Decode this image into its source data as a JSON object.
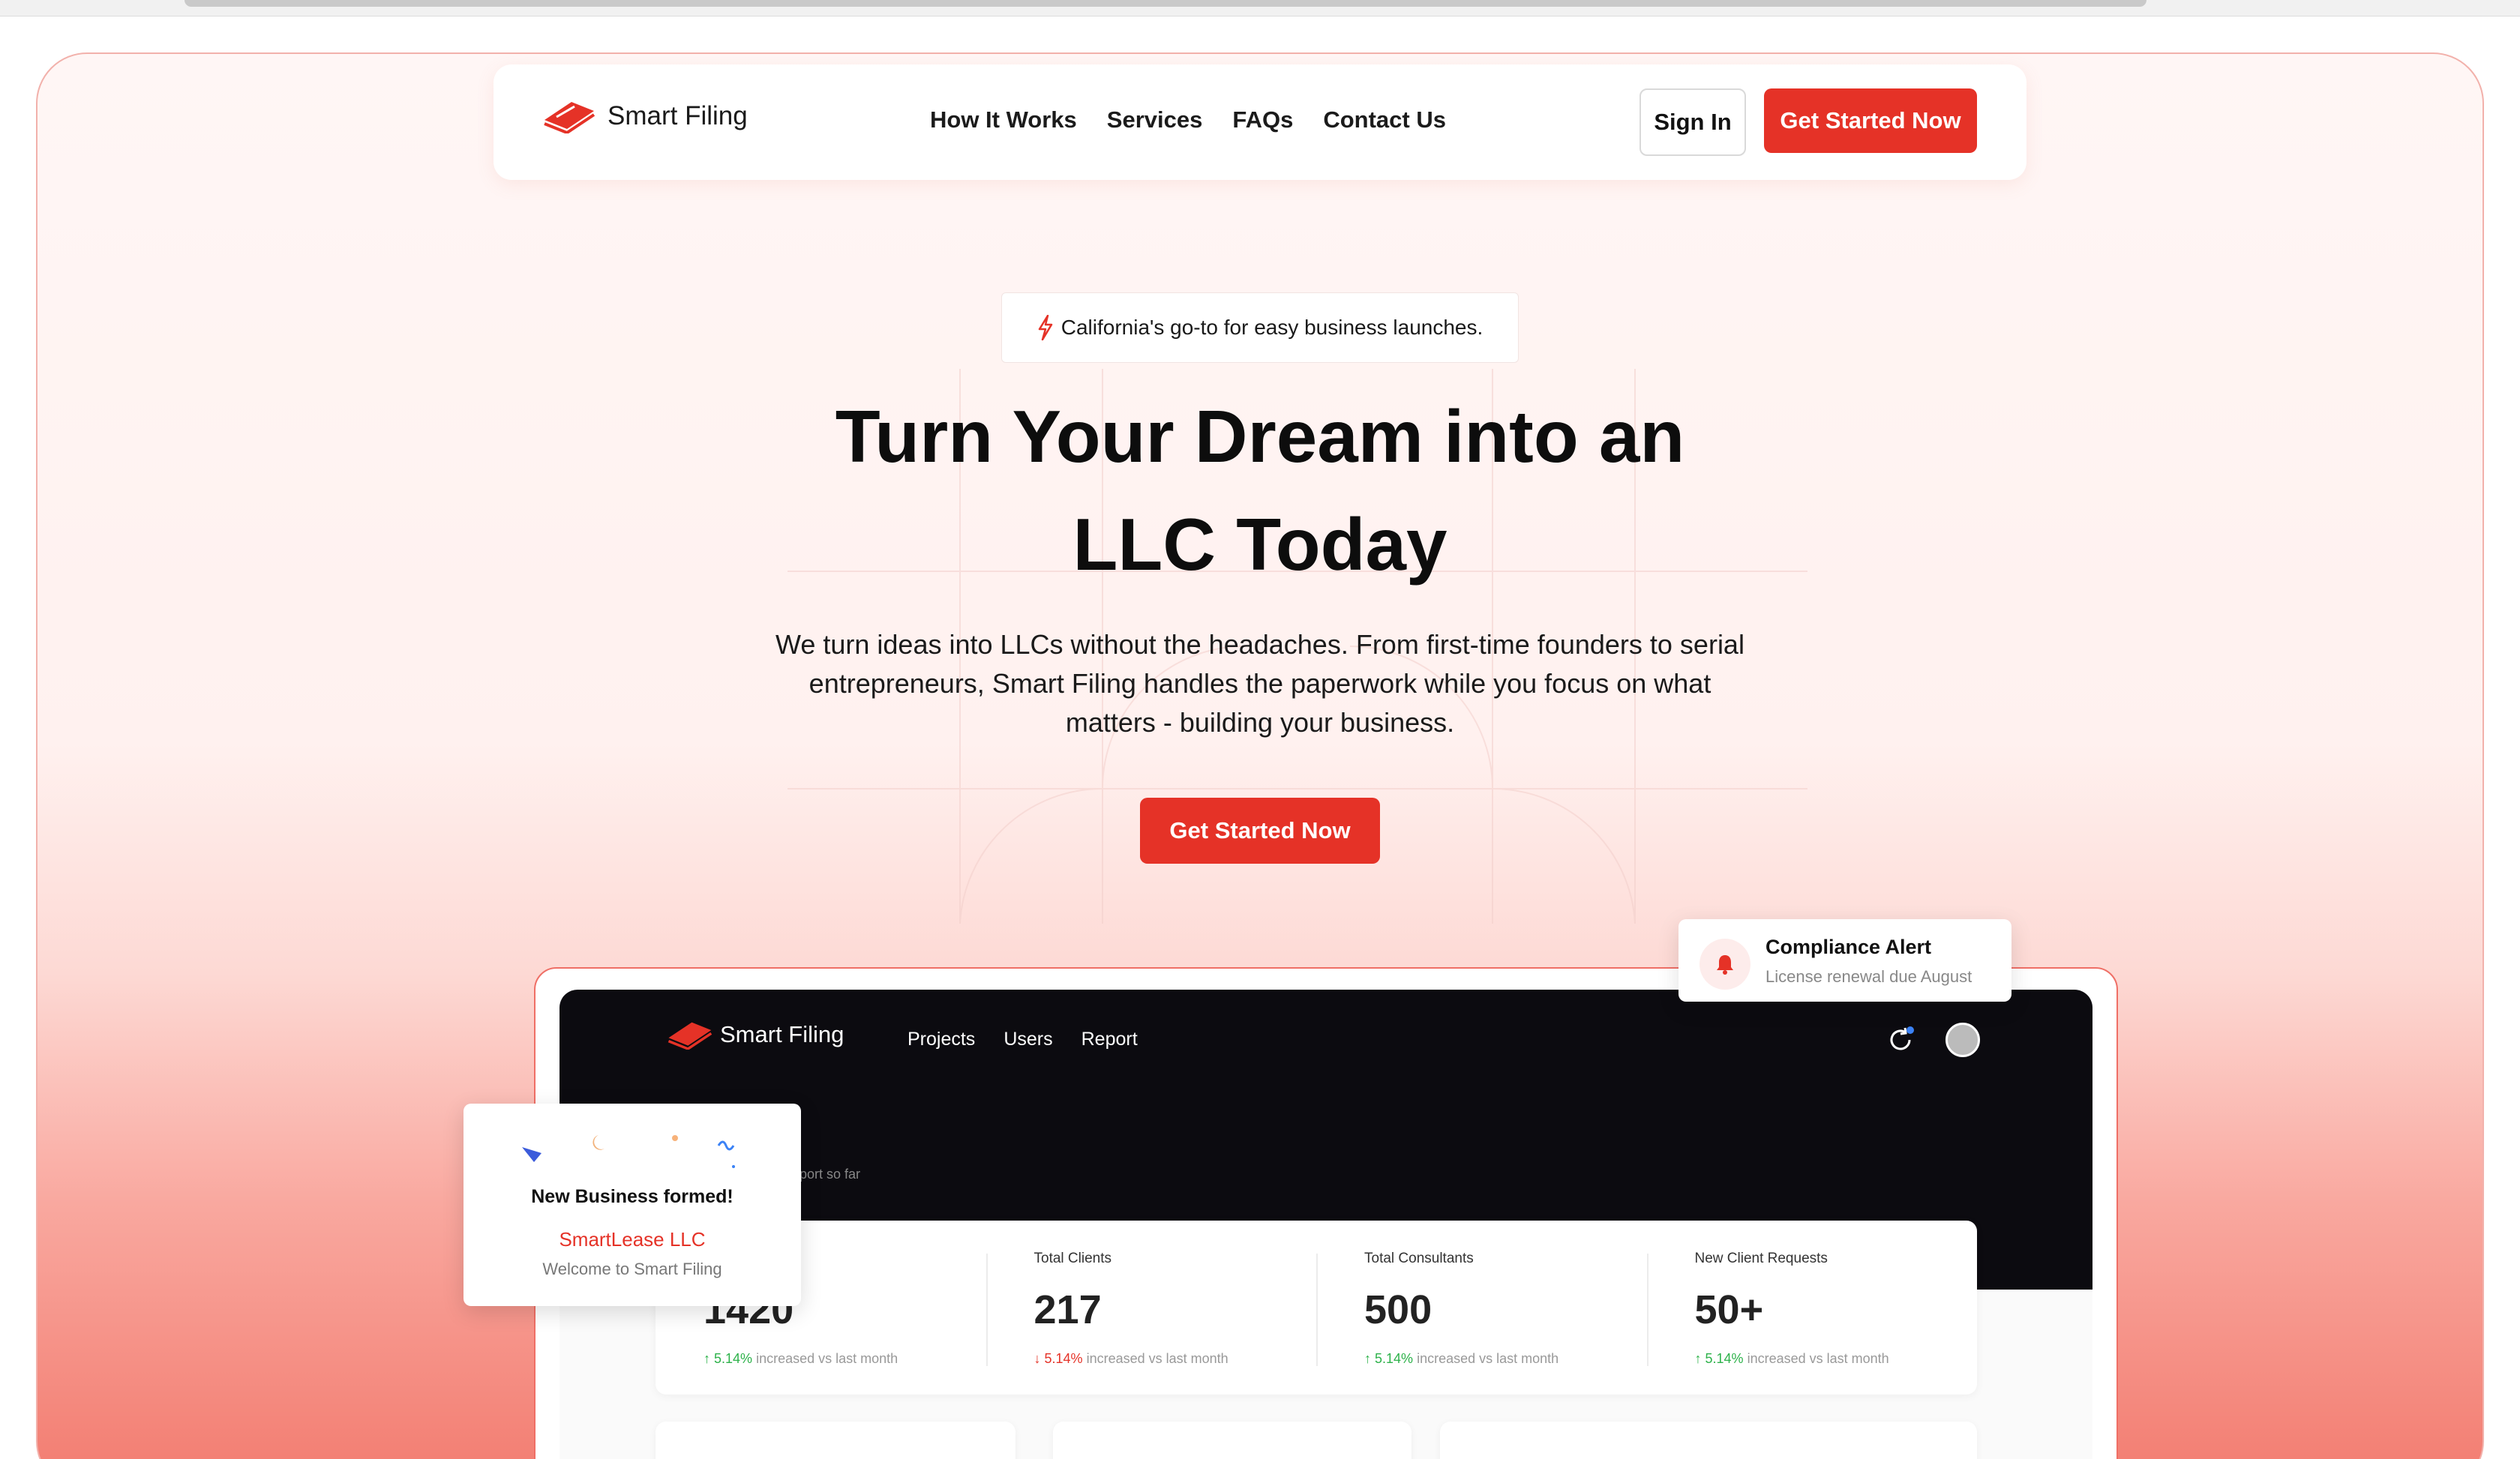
{
  "colors": {
    "accent": "#e53227",
    "dark": "#0c0b10",
    "trend_up": "#2db24a",
    "trend_down": "#e53227"
  },
  "nav": {
    "brand": "Smart Filing",
    "links": [
      "How It Works",
      "Services",
      "FAQs",
      "Contact Us"
    ],
    "sign_in": "Sign In",
    "cta": "Get Started Now"
  },
  "hero": {
    "tag_icon": "bolt-icon",
    "tag": "California's go-to for easy business launches.",
    "title_line1": "Turn Your Dream into an",
    "title_line2": "LLC Today",
    "subtitle": "We turn ideas into LLCs without the headaches. From first-time founders to serial entrepreneurs, Smart Filing handles the paperwork while you focus on what matters - building your business.",
    "cta": "Get Started Now"
  },
  "mockup": {
    "brand": "Smart Filing",
    "nav": [
      "Projects",
      "Users",
      "Report"
    ],
    "faint_text": "port so far",
    "stats": [
      {
        "label": "",
        "value": "1420",
        "trend": "5.14%",
        "trend_dir": "up",
        "trend_text": "increased vs last month"
      },
      {
        "label": "Total Clients",
        "value": "217",
        "trend": "5.14%",
        "trend_dir": "down",
        "trend_text": "increased vs last month"
      },
      {
        "label": "Total Consultants",
        "value": "500",
        "trend": "5.14%",
        "trend_dir": "up",
        "trend_text": "increased vs last month"
      },
      {
        "label": "New Client Requests",
        "value": "50+",
        "trend": "5.14%",
        "trend_dir": "up",
        "trend_text": "increased vs last month"
      }
    ]
  },
  "alert": {
    "title": "Compliance Alert",
    "subtitle": "License renewal due August"
  },
  "notification": {
    "title": "New Business formed!",
    "company": "SmartLease LLC",
    "subtitle": "Welcome to Smart Filing"
  }
}
